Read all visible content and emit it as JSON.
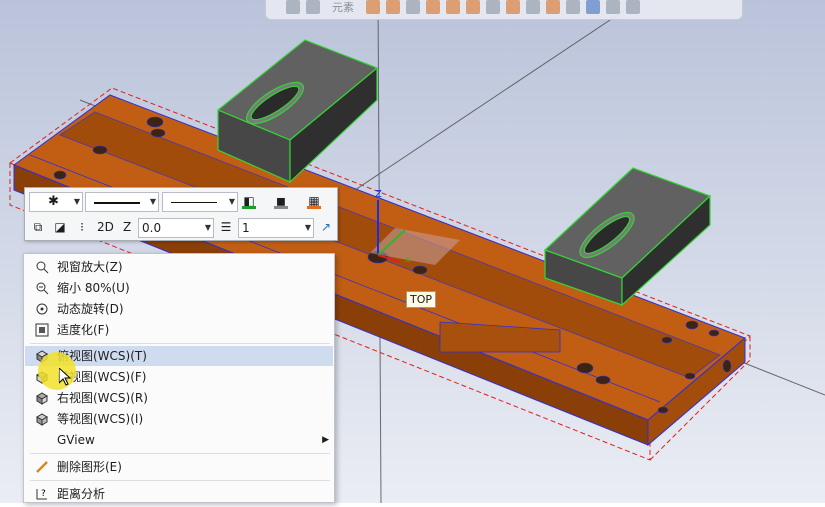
{
  "top_toolbar": {
    "select_label": "元素"
  },
  "attr_toolbar": {
    "point_style": "✱",
    "view_mode": "2D",
    "z_label": "Z",
    "z_value": "0.0",
    "level_value": "1"
  },
  "view_label": "TOP",
  "context_menu": {
    "items": [
      {
        "label": "视窗放大(Z)",
        "icon": "zoom-window-icon"
      },
      {
        "label": "缩小 80%(U)",
        "icon": "zoom-out-icon"
      },
      {
        "label": "动态旋转(D)",
        "icon": "dynamic-rotate-icon"
      },
      {
        "label": "适度化(F)",
        "icon": "fit-icon"
      },
      {
        "label": "俯视图(WCS)(T)",
        "icon": "top-view-icon"
      },
      {
        "label": "前视图(WCS)(F)",
        "icon": "front-view-icon"
      },
      {
        "label": "右视图(WCS)(R)",
        "icon": "right-view-icon"
      },
      {
        "label": "等视图(WCS)(I)",
        "icon": "isometric-view-icon"
      },
      {
        "label": "GView",
        "icon": ""
      },
      {
        "label": "删除图形(E)",
        "icon": "delete-entity-icon"
      },
      {
        "label": "距离分析",
        "icon": "distance-analysis-icon"
      }
    ]
  },
  "colors": {
    "background_top": "#bfc7dc",
    "background_bottom": "#e9ecf3",
    "part_orange": "#b65a10",
    "part_outline": "#2f2fd6",
    "bbox_red": "#e0201a",
    "clamp_gray": "#3f3f3f",
    "clamp_outline": "#33d633",
    "menu_highlight": "#cfdcf0"
  }
}
